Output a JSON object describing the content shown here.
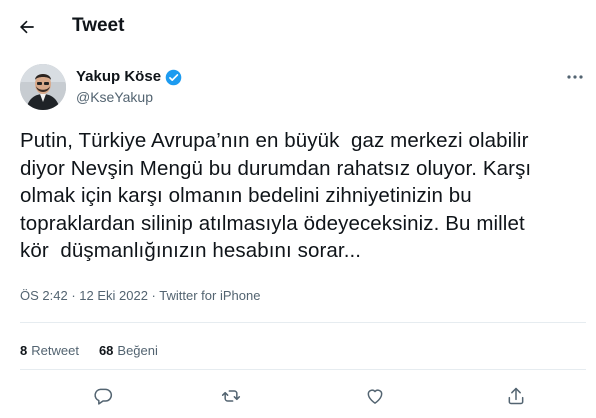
{
  "header": {
    "title": "Tweet"
  },
  "author": {
    "name": "Yakup Köse",
    "handle": "@KseYakup"
  },
  "tweet": {
    "lines": [
      "Putin, Türkiye Avrupa’nın en büyük  gaz merkezi olabilir",
      "diyor Nevşin Mengü bu durumdan rahatsız oluyor. Karşı",
      "olmak için karşı olmanın bedelini zihniyetinizin bu",
      "topraklardan silinip atılmasıyla ödeyeceksiniz. Bu millet",
      "kör  düşmanlığınızın hesabını sorar..."
    ],
    "time": "ÖS 2:42",
    "date": "12 Eki 2022",
    "source": "Twitter for iPhone",
    "separator": " · "
  },
  "stats": {
    "retweets_count": "8",
    "retweets_label": "Retweet",
    "likes_count": "68",
    "likes_label": "Beğeni"
  },
  "colors": {
    "text": "#0f1419",
    "secondary": "#536471",
    "verified": "#1d9bf0",
    "divider": "#e6ecf0"
  },
  "icons": [
    "back-arrow-icon",
    "verified-badge-icon",
    "more-icon",
    "reply-icon",
    "retweet-icon",
    "like-icon",
    "share-icon"
  ]
}
